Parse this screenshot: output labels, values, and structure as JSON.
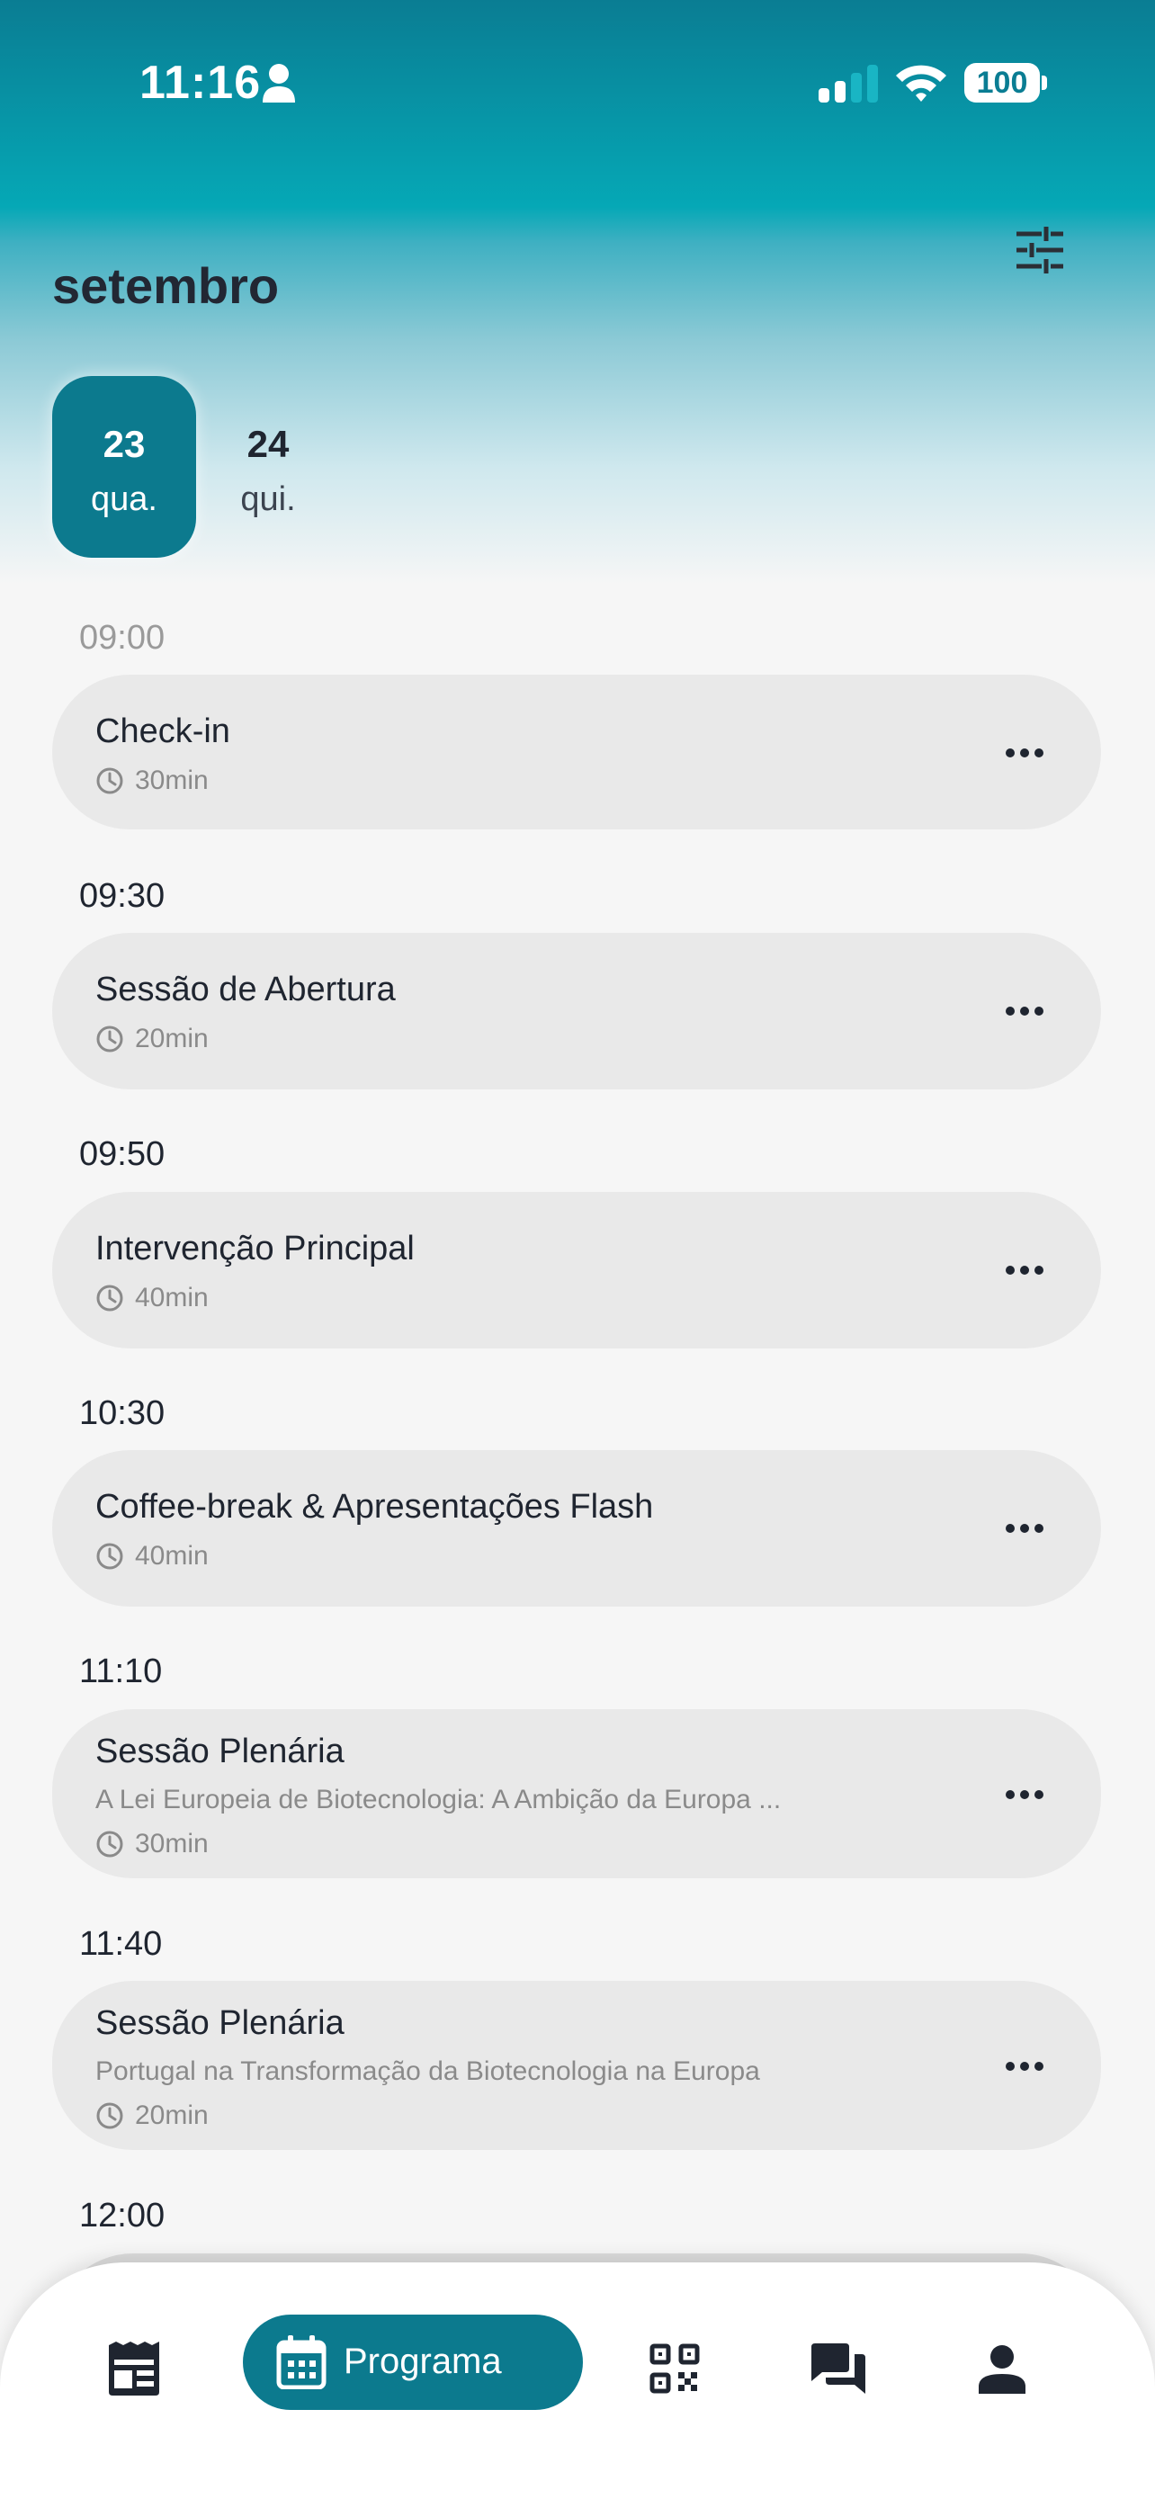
{
  "status_bar": {
    "time": "11:16",
    "battery": "100"
  },
  "calendar": {
    "month": "setembro",
    "days": [
      {
        "num": "23",
        "weekday": "qua.",
        "selected": true
      },
      {
        "num": "24",
        "weekday": "qui.",
        "selected": false
      }
    ]
  },
  "schedule": [
    {
      "time": "09:00",
      "title": "Check-in",
      "subtitle": "",
      "duration": "30min"
    },
    {
      "time": "09:30",
      "title": "Sessão de Abertura",
      "subtitle": "",
      "duration": "20min"
    },
    {
      "time": "09:50",
      "title": "Intervenção Principal",
      "subtitle": "",
      "duration": "40min"
    },
    {
      "time": "10:30",
      "title": "Coffee-break & Apresentações Flash",
      "subtitle": "",
      "duration": "40min"
    },
    {
      "time": "11:10",
      "title": "Sessão Plenária",
      "subtitle": "A Lei Europeia de Biotecnologia: A Ambição da Europa ...",
      "duration": "30min"
    },
    {
      "time": "11:40",
      "title": "Sessão Plenária",
      "subtitle": "Portugal na Transformação da Biotecnologia na Europa",
      "duration": "20min"
    },
    {
      "time": "12:00",
      "title": "",
      "subtitle": "",
      "duration": ""
    }
  ],
  "nav": {
    "active_label": "Programa",
    "items": [
      "news-icon",
      "calendar-icon",
      "qr-code-icon",
      "chat-icon",
      "profile-icon"
    ]
  },
  "colors": {
    "accent": "#0c7a8e",
    "card": "#e9e9e9",
    "background": "#f6f6f6"
  }
}
